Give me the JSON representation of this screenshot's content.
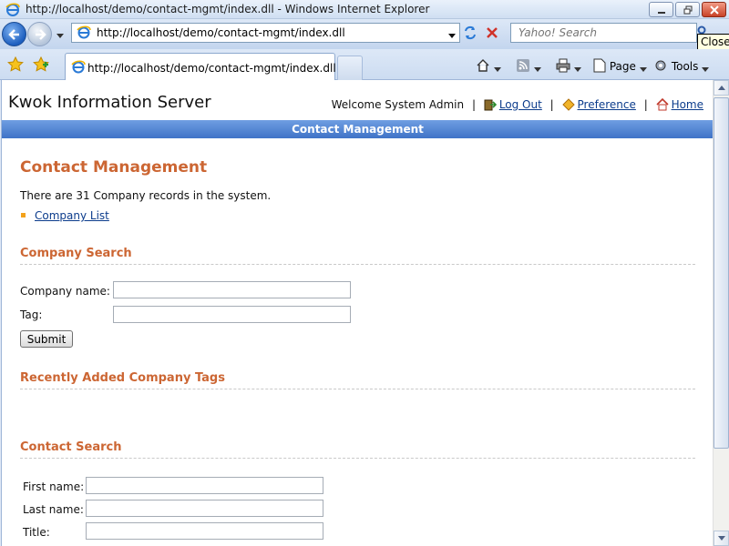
{
  "window": {
    "title": "http://localhost/demo/contact-mgmt/index.dll - Windows Internet Explorer",
    "close_tooltip": "Close"
  },
  "browser": {
    "address": "http://localhost/demo/contact-mgmt/index.dll",
    "search_placeholder": "Yahoo! Search",
    "tab_label": "http://localhost/demo/contact-mgmt/index.dll",
    "commands": {
      "page": "Page",
      "tools": "Tools"
    }
  },
  "header": {
    "site_title": "Kwok Information Server",
    "welcome": "Welcome System Admin",
    "logout": "Log Out",
    "preference": "Preference",
    "home": "Home",
    "separator": "|"
  },
  "banner": {
    "title": "Contact Management"
  },
  "main": {
    "heading": "Contact Management",
    "record_count": "There are 31 Company records in the system.",
    "company_list_link": "Company List",
    "company_search": {
      "heading": "Company Search",
      "company_name_label": "Company name:",
      "company_name_value": "",
      "tag_label": "Tag:",
      "tag_value": "",
      "submit_label": "Submit"
    },
    "recent_tags": {
      "heading": "Recently Added Company Tags"
    },
    "contact_search": {
      "heading": "Contact Search",
      "first_name_label": "First name:",
      "first_name_value": "",
      "last_name_label": "Last name:",
      "last_name_value": "",
      "title_label": "Title:",
      "title_value": ""
    }
  },
  "colors": {
    "heading": "#cc6633",
    "banner_top": "#6f9ee2",
    "banner_bottom": "#3f73c7",
    "link": "#0c3c8c",
    "bullet": "#f3a21b"
  },
  "icons": {
    "back": "back-arrow-icon",
    "forward": "forward-arrow-icon",
    "refresh": "refresh-icon",
    "stop": "stop-icon",
    "search": "search-icon",
    "favorites": "favorites-star-icon",
    "add_favorite": "add-favorite-icon",
    "home": "home-icon",
    "feeds": "rss-feed-icon",
    "print": "print-icon",
    "tools": "gear-icon"
  }
}
